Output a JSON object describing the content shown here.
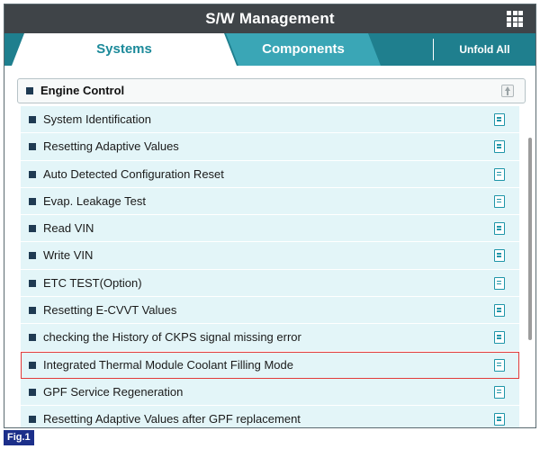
{
  "titlebar": {
    "title": "S/W Management",
    "menu_icon": "grid-menu-icon"
  },
  "tabs": {
    "systems": "Systems",
    "components": "Components",
    "active": "Systems",
    "unfold_all": "Unfold All"
  },
  "group": {
    "label": "Engine Control",
    "collapse_icon": "collapse-up-icon"
  },
  "items": [
    {
      "label": "System Identification"
    },
    {
      "label": "Resetting Adaptive Values"
    },
    {
      "label": "Auto Detected Configuration Reset"
    },
    {
      "label": "Evap. Leakage Test"
    },
    {
      "label": "Read VIN"
    },
    {
      "label": "Write VIN"
    },
    {
      "label": "ETC TEST(Option)"
    },
    {
      "label": "Resetting E-CVVT Values"
    },
    {
      "label": "checking the History of  CKPS signal missing error"
    },
    {
      "label": "Integrated Thermal Module Coolant Filling Mode",
      "selected": true
    },
    {
      "label": "GPF Service Regeneration"
    },
    {
      "label": "Resetting Adaptive Values after GPF replacement"
    }
  ],
  "figure_label": "Fig.1",
  "colors": {
    "titlebar": "#3f4448",
    "tabbar": "#1f7f8e",
    "active_tab_text": "#1c8a9a",
    "inactive_tab": "#3aa6b6",
    "row_bg": "#e3f5f8",
    "selection_outline": "#e23a3a",
    "doc_icon": "#1f95a8",
    "figure_badge": "#1c2f8a"
  }
}
